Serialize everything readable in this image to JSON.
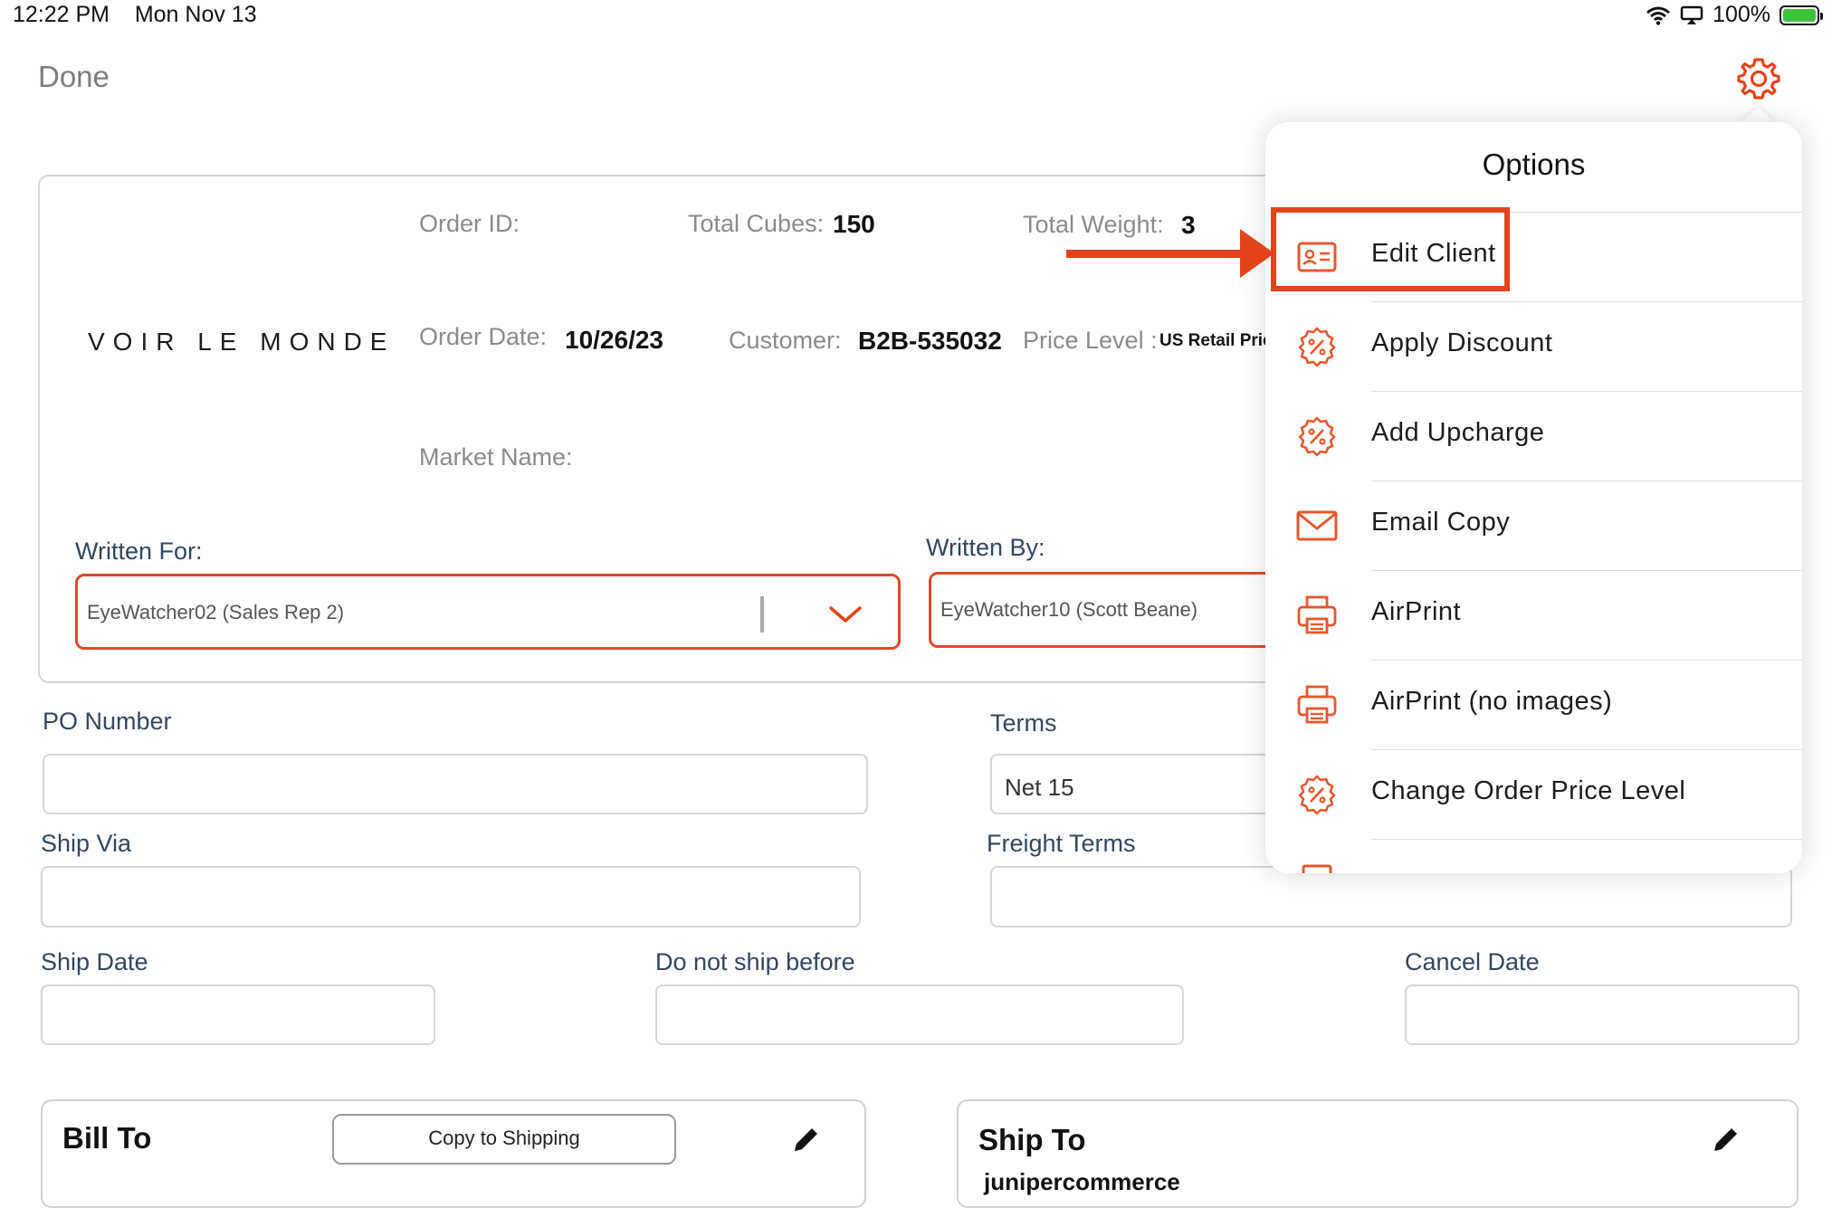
{
  "status_bar": {
    "time": "12:22 PM",
    "date": "Mon Nov 13",
    "battery": "100%",
    "battery_level": 1.0,
    "icons": [
      "wifi-icon",
      "airplay-icon",
      "battery-charging-icon"
    ]
  },
  "nav": {
    "done_label": "Done",
    "settings_icon": "gear-icon"
  },
  "order": {
    "logo": "VOIR LE MONDE",
    "order_id_label": "Order ID:",
    "order_id_value": "",
    "total_cubes_label": "Total Cubes:",
    "total_cubes_value": "150",
    "total_weight_label": "Total Weight:",
    "total_weight_value": "3",
    "order_date_label": "Order Date:",
    "order_date_value": "10/26/23",
    "customer_label": "Customer:",
    "customer_value": "B2B-535032",
    "price_level_label": "Price Level :",
    "price_level_value": "US Retail Pric",
    "market_name_label": "Market Name:",
    "written_for_label": "Written For:",
    "written_for_value": "EyeWatcher02 (Sales Rep 2)",
    "written_by_label": "Written By:",
    "written_by_value": "EyeWatcher10 (Scott Beane)"
  },
  "form": {
    "po_number_label": "PO Number",
    "po_number_value": "",
    "terms_label": "Terms",
    "terms_value": "Net 15",
    "ship_via_label": "Ship Via",
    "freight_terms_label": "Freight Terms",
    "ship_date_label": "Ship Date",
    "do_not_ship_label": "Do not ship before",
    "cancel_date_label": "Cancel Date"
  },
  "bill_to": {
    "title": "Bill To",
    "copy_button": "Copy to Shipping"
  },
  "ship_to": {
    "title": "Ship To",
    "partial_text": "junipercommerce"
  },
  "options": {
    "title": "Options",
    "items": [
      {
        "label": "Edit Client",
        "icon": "contact-card-icon"
      },
      {
        "label": "Apply Discount",
        "icon": "discount-badge-icon"
      },
      {
        "label": "Add Upcharge",
        "icon": "upcharge-badge-icon"
      },
      {
        "label": "Email Copy",
        "icon": "envelope-icon"
      },
      {
        "label": "AirPrint",
        "icon": "printer-icon"
      },
      {
        "label": "AirPrint (no images)",
        "icon": "printer-icon"
      },
      {
        "label": "Change Order Price Level",
        "icon": "price-level-badge-icon"
      }
    ]
  },
  "colors": {
    "accent": "#e4431c",
    "icon_orange": "#e8572f",
    "label_blue": "#33465e"
  }
}
